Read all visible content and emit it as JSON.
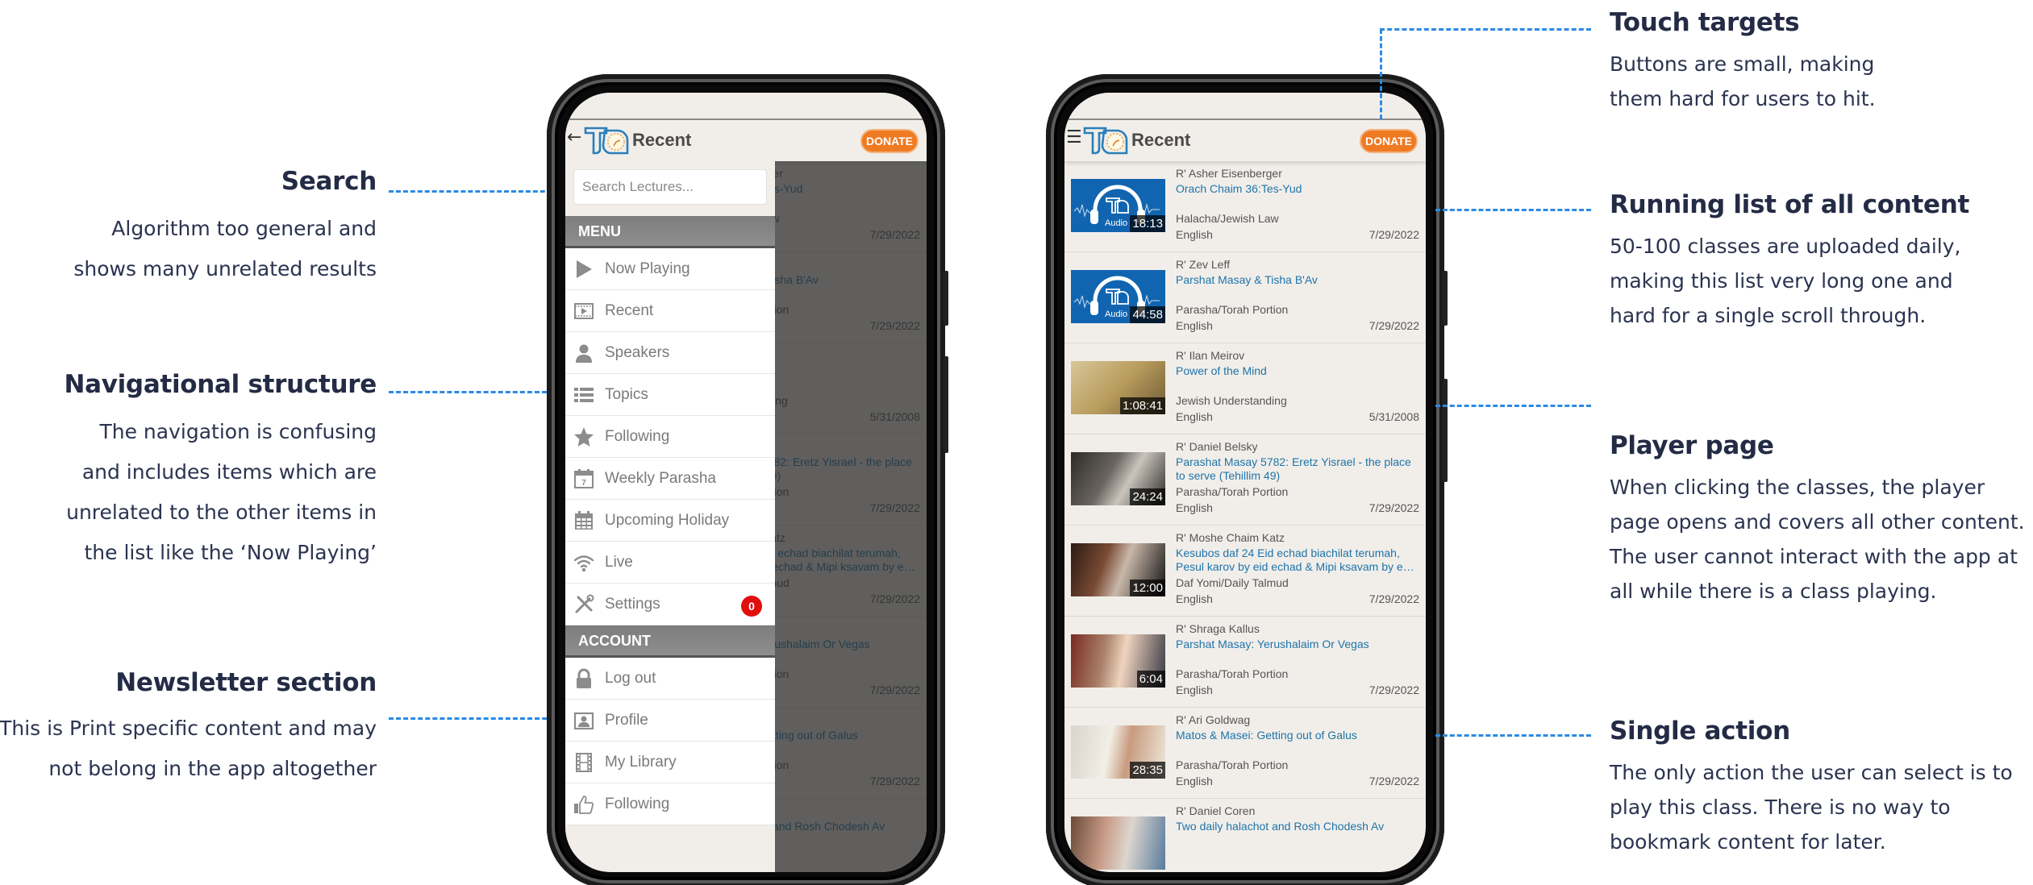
{
  "annotations": {
    "left": [
      {
        "title": "Search",
        "lines": [
          "Algorithm too general and",
          "shows many unrelated results"
        ]
      },
      {
        "title": "Navigational structure",
        "lines": [
          "The navigation is confusing",
          "and includes items which are",
          "unrelated to the other items in",
          "the list like the ‘Now Playing’"
        ]
      },
      {
        "title": "Newsletter section",
        "lines": [
          "This is Print specific content and may",
          "not belong in the app altogether"
        ]
      }
    ],
    "right": [
      {
        "title": "Touch targets",
        "lines": [
          "Buttons are small, making",
          "them hard for users to hit."
        ]
      },
      {
        "title": "Running list of all content",
        "lines": [
          "50-100 classes are uploaded daily,",
          "making this list very long one and",
          "hard for a single scroll through."
        ]
      },
      {
        "title": "Player page",
        "lines": [
          "When clicking the classes, the player",
          "page opens and covers all other content.",
          "The user cannot interact with the app at",
          "all while there is a class playing."
        ]
      },
      {
        "title": "Single action",
        "lines": [
          "The only action the user can select is to",
          "play this class. There is no way to",
          "bookmark content for later."
        ]
      }
    ]
  },
  "colors": {
    "accent_connector": "#2a8ae6",
    "donate": "#ee7a22",
    "link_title": "#1f74a8",
    "badge": "#e10e0e",
    "app_bg": "#f1eeea"
  },
  "app": {
    "header_title": "Recent",
    "donate_label": "DONATE",
    "back_icon": "arrow-left-icon",
    "menu_icon": "hamburger-icon"
  },
  "drawer": {
    "search_placeholder": "Search Lectures...",
    "menu_header": "MENU",
    "menu_items": [
      {
        "label": "Now Playing",
        "icon": "play-icon"
      },
      {
        "label": "Recent",
        "icon": "film-play-icon"
      },
      {
        "label": "Speakers",
        "icon": "person-icon"
      },
      {
        "label": "Topics",
        "icon": "list-icon"
      },
      {
        "label": "Following",
        "icon": "star-icon"
      },
      {
        "label": "Weekly Parasha",
        "icon": "calendar-7-icon"
      },
      {
        "label": "Upcoming Holiday",
        "icon": "calendar-grid-icon"
      },
      {
        "label": "Live",
        "icon": "wifi-icon"
      },
      {
        "label": "Settings",
        "icon": "tools-icon",
        "badge": "0"
      }
    ],
    "account_header": "ACCOUNT",
    "account_items": [
      {
        "label": "Log out",
        "icon": "lock-icon"
      },
      {
        "label": "Profile",
        "icon": "profile-card-icon"
      },
      {
        "label": "My Library",
        "icon": "film-strip-icon"
      },
      {
        "label": "Following",
        "icon": "thumbs-up-icon"
      }
    ]
  },
  "lectures": [
    {
      "speaker": "R' Asher Eisenberger",
      "title": "Orach Chaim 36:Tes-Yud",
      "category": "Halacha/Jewish Law",
      "language": "English",
      "date": "7/29/2022",
      "duration": "18:13",
      "thumb": "audio",
      "thumb_label": "Audio"
    },
    {
      "speaker": "R' Zev Leff",
      "title": "Parshat Masay & Tisha B'Av",
      "category": "Parasha/Torah Portion",
      "language": "English",
      "date": "7/29/2022",
      "duration": "44:58",
      "thumb": "audio",
      "thumb_label": "Audio"
    },
    {
      "speaker": "R' Ilan Meirov",
      "title": "Power of the Mind",
      "category": "Jewish Understanding",
      "language": "English",
      "date": "5/31/2008",
      "duration": "1:08:41",
      "thumb": "photo"
    },
    {
      "speaker": "R' Daniel Belsky",
      "title": "Parashat Masay 5782: Eretz Yisrael - the place to serve (Tehillim 49)",
      "category": "Parasha/Torah Portion",
      "language": "English",
      "date": "7/29/2022",
      "duration": "24:24",
      "thumb": "photo"
    },
    {
      "speaker": "R' Moshe Chaim Katz",
      "title": "Kesubos daf 24 Eid echad biachilat terumah, Pesul karov by eid echad & Mipi ksavam by e…",
      "category": "Daf Yomi/Daily Talmud",
      "language": "English",
      "date": "7/29/2022",
      "duration": "12:00",
      "thumb": "photo"
    },
    {
      "speaker": "R' Shraga Kallus",
      "title": "Parshat Masay: Yerushalaim Or Vegas",
      "category": "Parasha/Torah Portion",
      "language": "English",
      "date": "7/29/2022",
      "duration": "6:04",
      "thumb": "photo"
    },
    {
      "speaker": "R' Ari Goldwag",
      "title": "Matos & Masei: Getting out of Galus",
      "category": "Parasha/Torah Portion",
      "language": "English",
      "date": "7/29/2022",
      "duration": "28:35",
      "thumb": "photo"
    },
    {
      "speaker": "R' Daniel Coren",
      "title": "Two daily halachot and Rosh Chodesh Av",
      "category": "",
      "language": "",
      "date": "",
      "duration": "",
      "thumb": "photo"
    }
  ]
}
